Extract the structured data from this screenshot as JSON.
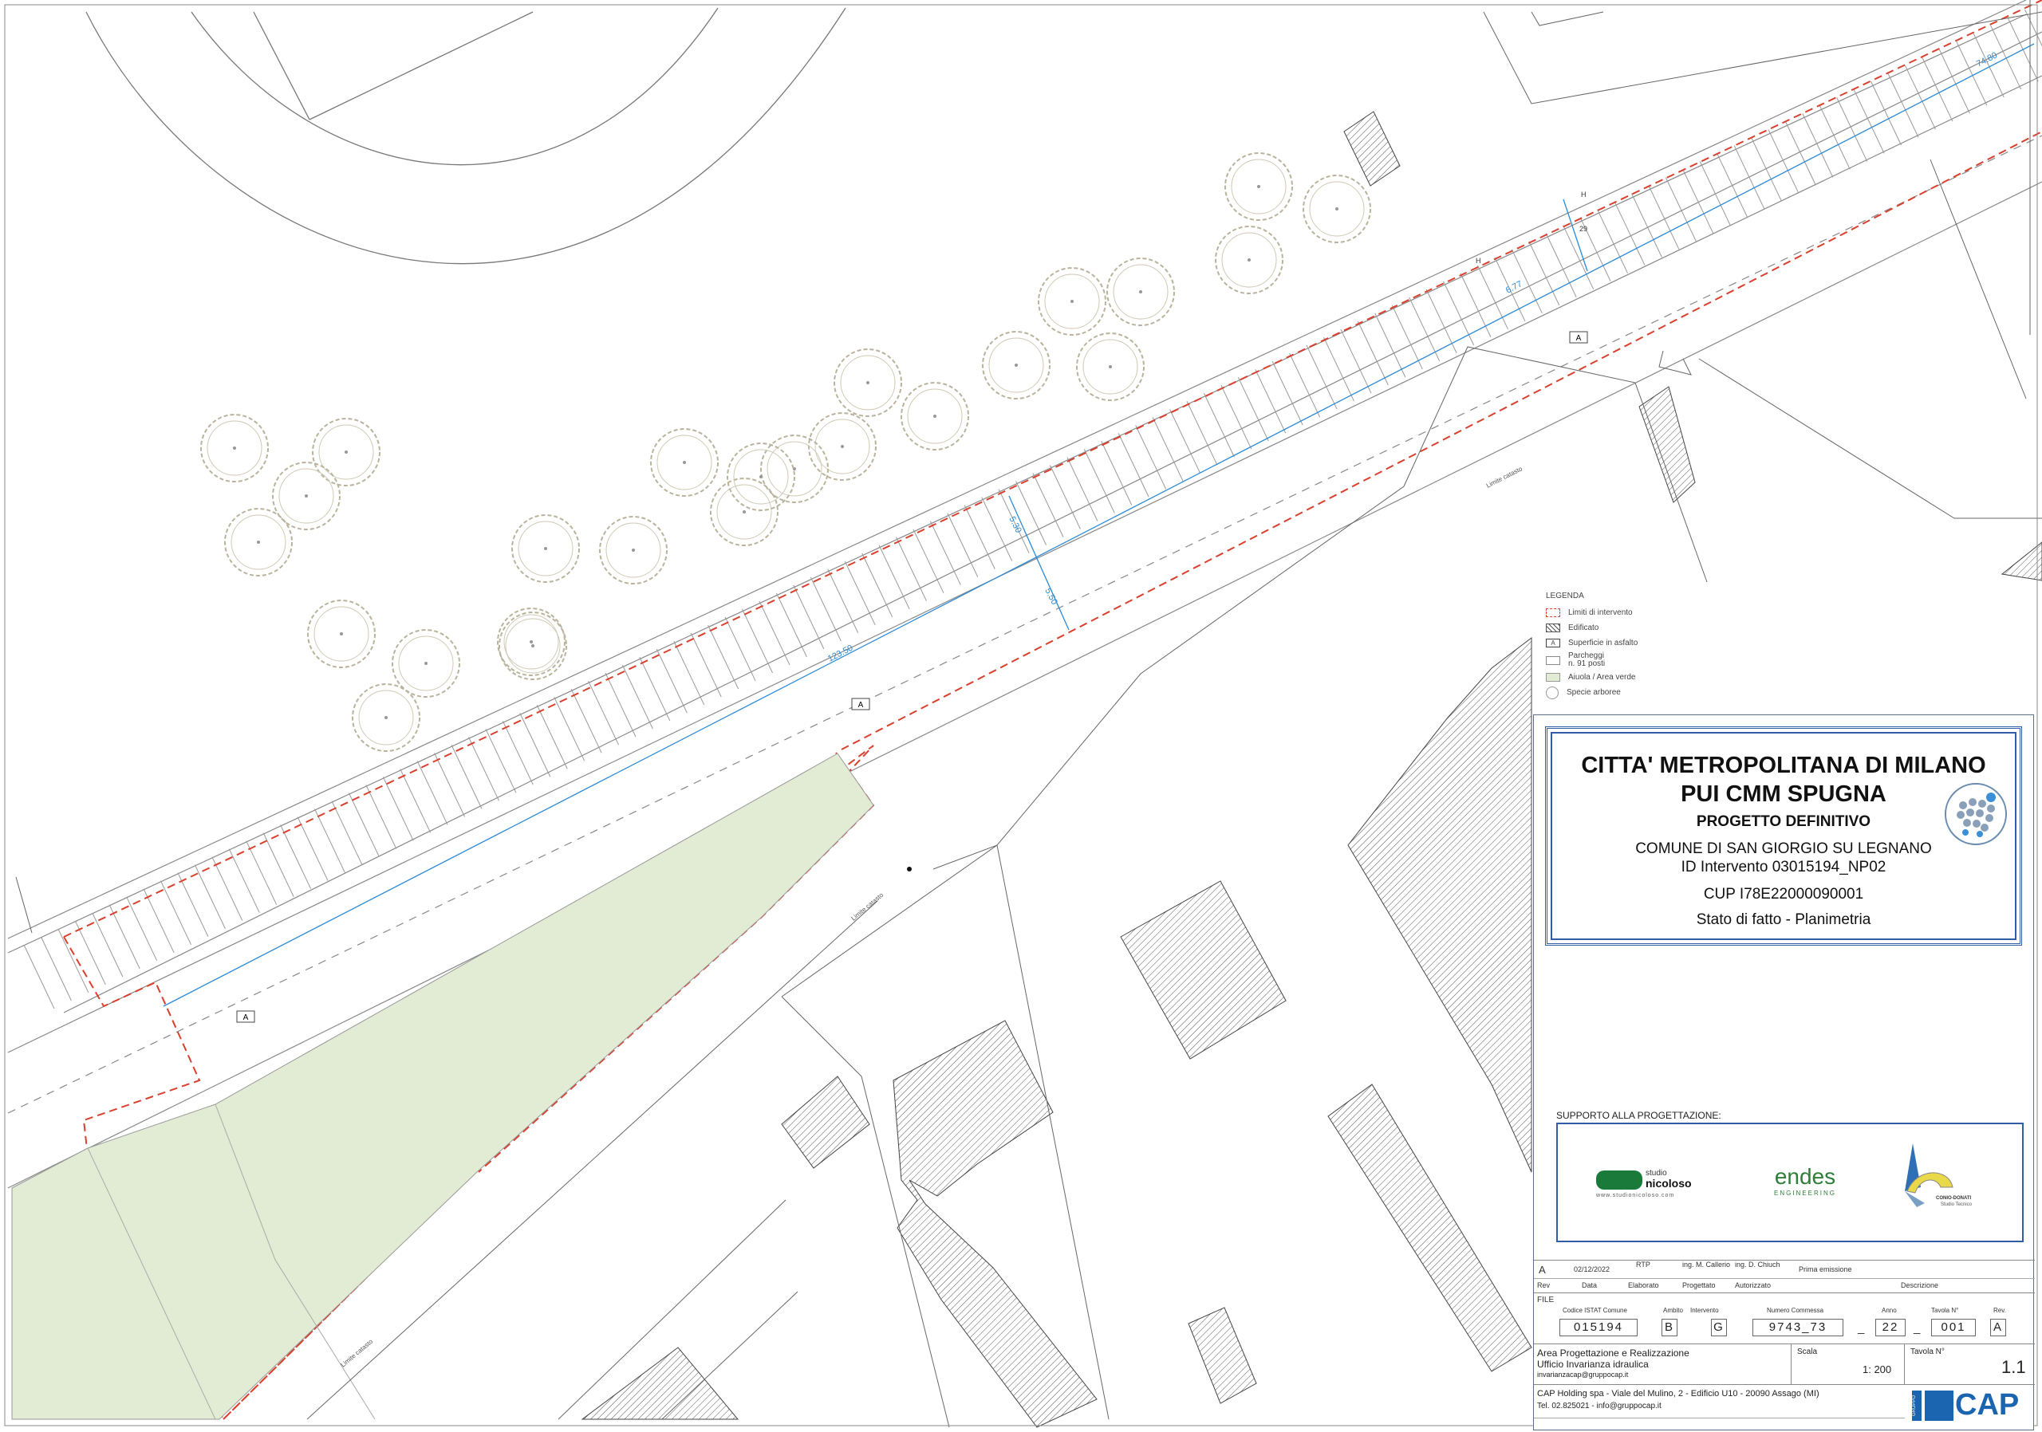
{
  "labels": {
    "dim_1": "123.50",
    "dim_2": "6.77",
    "dim_3": "5.50",
    "dim_4": "5.30",
    "dim_5": "74.80",
    "marker_a": "A",
    "limit_label": "Limite catasto",
    "stall_h": "H",
    "stall_29": "29"
  },
  "legend": {
    "title": "LEGENDA",
    "items": [
      {
        "label": "Limiti di intervento"
      },
      {
        "label": "Edificato"
      },
      {
        "label": "Superficie in asfalto",
        "mark": "A"
      },
      {
        "label": "Parcheggi"
      },
      {
        "label": "n. 91 posti"
      },
      {
        "label": "Aiuola / Area verde"
      },
      {
        "label": "Specie arboree"
      }
    ]
  },
  "title_block": {
    "line1": "CITTA' METROPOLITANA DI MILANO",
    "line2": "PUI CMM SPUGNA",
    "line3": "PROGETTO DEFINITIVO",
    "line4": "COMUNE DI SAN GIORGIO SU LEGNANO",
    "line5": "ID Intervento 03015194_NP02",
    "line6": "CUP I78E22000090001",
    "line7": "Stato di fatto - Planimetria",
    "support_label": "SUPPORTO ALLA PROGETTAZIONE:",
    "logo1_main": "studio",
    "logo1_name": "nicoloso",
    "logo1_url": "www.studionicoloso.com",
    "logo2": "endes",
    "logo2_sub": "ENGINEERING",
    "logo3": "CONIO-DONATI",
    "logo3_sub": "Studio Tecnico"
  },
  "revision": {
    "rev": "A",
    "date": "02/12/2022",
    "rtp": "RTP",
    "elaborato": "ing. M. Callerio",
    "autorizzato": "ing. D. Chiuch",
    "descrizione": "Prima emissione",
    "h_rev": "Rev",
    "h_data": "Data",
    "h_elab": "Elaborato",
    "h_prog": "Progettato",
    "h_aut": "Autorizzato",
    "h_desc": "Descrizione"
  },
  "file": {
    "label": "FILE",
    "h_istat": "Codice ISTAT Comune",
    "h_ambito": "Ambito",
    "h_intervento": "Intervento",
    "h_commessa": "Numero Commessa",
    "h_anno": "Anno",
    "h_tavola": "Tavola N°",
    "h_rev": "Rev.",
    "istat": "015194",
    "ambito": "B",
    "intervento": "G",
    "commessa": "9743_73",
    "sep1": "_",
    "anno": "22",
    "sep2": "_",
    "tavola": "001",
    "rev": "A"
  },
  "footer": {
    "area": "Area Progettazione e Realizzazione",
    "ufficio": "Ufficio Invarianza idraulica",
    "email": "invarianzacap@gruppocap.it",
    "scala_label": "Scala",
    "scala": "1: 200",
    "tavola_label": "Tavola N°",
    "tavola": "1.1",
    "address": "CAP Holding spa - Viale del Mulino, 2 - Edificio U10 - 20090 Assago (MI)",
    "tel": "Tel. 02.825021 - info@gruppocap.it",
    "brand": "CAP",
    "brand_pre": "GRUPPO"
  },
  "colors": {
    "limit": "#d9402e",
    "green": "#e2ecd4",
    "dim": "#2c8ad6",
    "frame": "#2f5da6",
    "cap": "#1a64b0"
  }
}
